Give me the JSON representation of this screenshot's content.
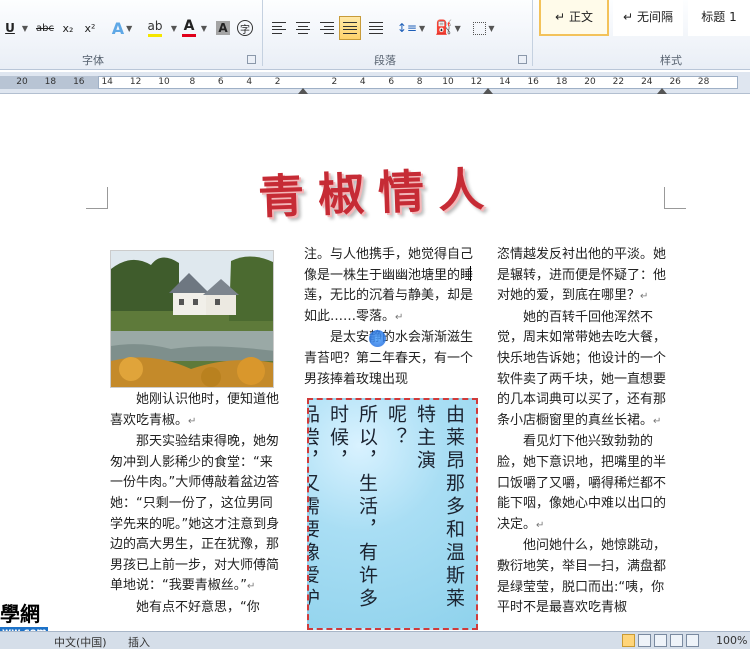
{
  "ribbon": {
    "groups": {
      "font": "字体",
      "paragraph": "段落",
      "styles": "样式"
    },
    "font_buttons": {
      "underline": "U",
      "strikethrough": "abc",
      "subscript": "x₂",
      "superscript": "x²",
      "char_shading": "A",
      "enclose": "字"
    },
    "styles": [
      {
        "label": "正文",
        "prefix": "↵",
        "active": true
      },
      {
        "label": "无间隔",
        "prefix": "↵",
        "active": false
      },
      {
        "label": "标题 1",
        "prefix": "",
        "active": false
      }
    ],
    "colors": {
      "highlight": "#f5e600",
      "font_color": "#e0001a",
      "accent": "#f3c25a"
    }
  },
  "ruler": {
    "numbers": [
      "20",
      "18",
      "16",
      "14",
      "12",
      "10",
      "8",
      "6",
      "4",
      "2",
      "",
      "2",
      "4",
      "6",
      "8",
      "10",
      "12",
      "14",
      "16",
      "18",
      "20",
      "22",
      "24",
      "26",
      "28"
    ]
  },
  "document": {
    "title": "青椒情人",
    "col1": [
      {
        "text": "她刚认识他时，便知道他喜欢吃青椒。",
        "indent": true
      },
      {
        "text": "那天实验结束得晚，她匆匆冲到人影稀少的食堂：“来一份牛肉。”大师傅敲着盆边答她：“只剩一份了，这位男同学先来的呢。”她这才注意到身边的高大男生，正在犹豫，那男孩已上前一步，对大师傅简单地说：“我要青椒丝。”",
        "indent": true
      },
      {
        "text": "她有点不好意思，“你",
        "indent": true
      }
    ],
    "col2": [
      {
        "text": "注。与人他携手，她觉得自己像是一株生于幽幽池塘里的睡莲，无比的沉着与静美，却是如此……零落。",
        "indent": false
      },
      {
        "text": "是太安静的水会渐渐滋生青苔吧？第二年春天，有一个男孩捧着玫瑰出现",
        "indent": true
      }
    ],
    "col3": [
      {
        "text": "恣情越发反衬出他的平淡。她是辗转，进而便是怀疑了：他对她的爱，到底在哪里？",
        "indent": false
      },
      {
        "text": "她的百转千回他浑然不觉，周末如常带她去吃大餐，快乐地告诉她；他设计的一个软件卖了两千块，她一直想要的几本词典可以买了，还有那条小店橱窗里的真丝长裙。",
        "indent": true
      },
      {
        "text": "看见灯下他兴致勃勃的脸，她下意识地，把嘴里的半口饭嚼了又嚼，嚼得稀烂都不能下咽，像她心中难以出口的决定。",
        "indent": true
      },
      {
        "text": "他问她什么，她惊跳动，敷衍地笑，举目一扫，满盘都是绿莹莹，脱口而出:“咦，你平时不是最喜欢吃青椒",
        "indent": true
      }
    ],
    "textbox": {
      "lines": [
        "由莱昂那多和温斯莱特主演",
        "呢？",
        "所以，生活，有许多时候，",
        "品尝，又需要像爱护一件瓷器"
      ]
    }
  },
  "watermark": {
    "text": "學網",
    "url": "ww.com"
  },
  "status_bar": {
    "language": "中文(中国)",
    "mode": "插入",
    "zoom": "100%"
  }
}
